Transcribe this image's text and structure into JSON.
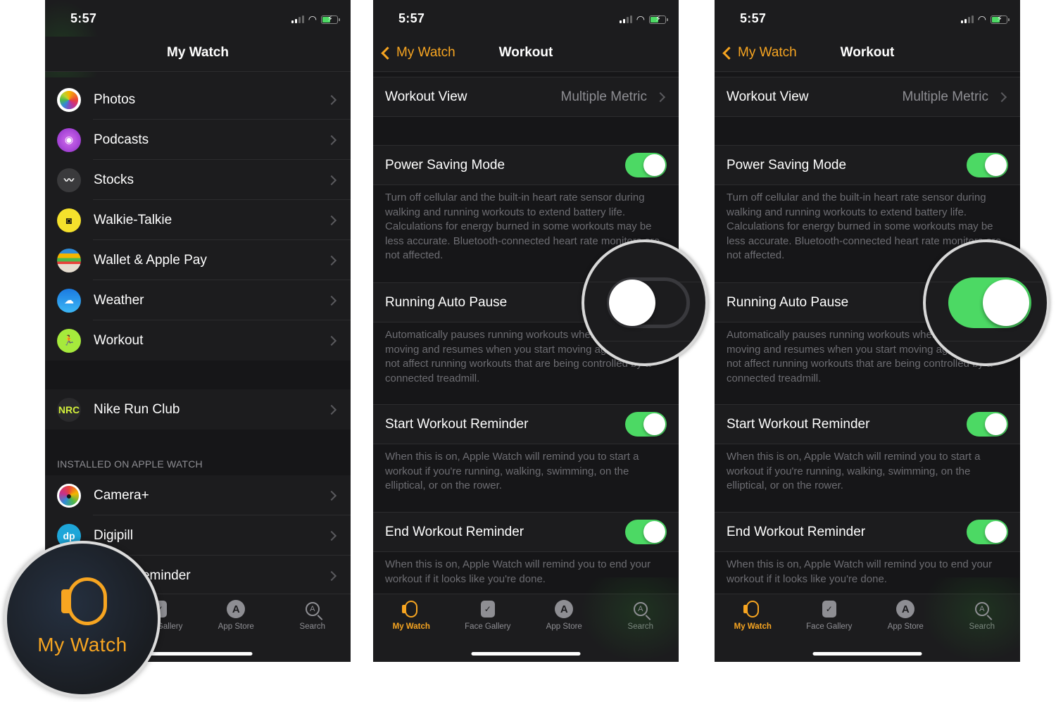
{
  "status_bar": {
    "time": "5:57"
  },
  "panel1": {
    "title": "My Watch",
    "apps": [
      {
        "label": "Photos",
        "icon": "photos-icon",
        "glyph": ""
      },
      {
        "label": "Podcasts",
        "icon": "podcasts-icon",
        "glyph": "◉"
      },
      {
        "label": "Stocks",
        "icon": "stocks-icon",
        "glyph": "〰"
      },
      {
        "label": "Walkie-Talkie",
        "icon": "walkie-talkie-icon",
        "glyph": "◙"
      },
      {
        "label": "Wallet & Apple Pay",
        "icon": "wallet-icon",
        "glyph": ""
      },
      {
        "label": "Weather",
        "icon": "weather-icon",
        "glyph": "☁"
      },
      {
        "label": "Workout",
        "icon": "workout-icon",
        "glyph": "🏃"
      }
    ],
    "third_party": [
      {
        "label": "Nike Run Club",
        "icon": "nike-run-club-icon",
        "glyph": "NRC"
      }
    ],
    "section_header": "INSTALLED ON APPLE WATCH",
    "installed": [
      {
        "label": "Camera+",
        "icon": "camera-plus-icon",
        "glyph": "●"
      },
      {
        "label": "Digipill",
        "icon": "digipill-icon",
        "glyph": "dp"
      },
      {
        "label": "Water Reminder",
        "icon": "water-reminder-icon",
        "glyph": ""
      }
    ],
    "magnifier_label": "My Watch"
  },
  "workout": {
    "back_label": "My Watch",
    "title": "Workout",
    "workout_view": {
      "label": "Workout View",
      "value": "Multiple Metric"
    },
    "power_saving": {
      "label": "Power Saving Mode",
      "on": true,
      "footer": "Turn off cellular and the built-in heart rate sensor during walking and running workouts to extend battery life. Calculations for energy burned in some workouts may be less accurate. Bluetooth-connected heart rate monitors are not affected."
    },
    "auto_pause": {
      "label": "Running Auto Pause",
      "footer": "Automatically pauses running workouts when you stop moving and resumes when you start moving again. This will not affect running workouts that are being controlled by a connected treadmill."
    },
    "start_reminder": {
      "label": "Start Workout Reminder",
      "on": true,
      "footer": "When this is on, Apple Watch will remind you to start a workout if you're running, walking, swimming, on the elliptical, or on the rower."
    },
    "end_reminder": {
      "label": "End Workout Reminder",
      "on": true,
      "footer": "When this is on, Apple Watch will remind you to end your workout if it looks like you're done."
    }
  },
  "panel2": {
    "auto_pause_on": false
  },
  "panel3": {
    "auto_pause_on": true
  },
  "tabbar": {
    "tabs": [
      {
        "label": "My Watch",
        "icon": "my-watch-icon"
      },
      {
        "label": "Face Gallery",
        "icon": "face-gallery-icon"
      },
      {
        "label": "App Store",
        "icon": "app-store-icon"
      },
      {
        "label": "Search",
        "icon": "search-icon"
      }
    ],
    "active": "My Watch"
  },
  "colors": {
    "accent": "#f7a521",
    "toggle_on": "#4cd964",
    "background": "#1c1c1e",
    "secondary_text": "#8e8e93"
  }
}
